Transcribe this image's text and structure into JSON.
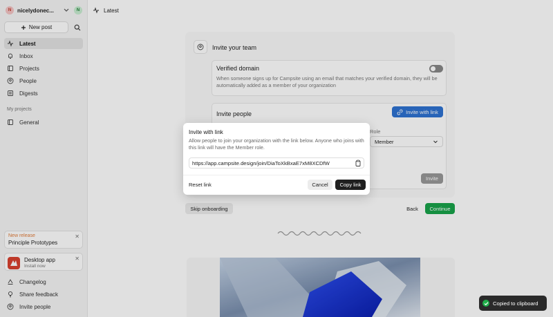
{
  "sidebar": {
    "org_initial": "N",
    "org_name": "nicelydonec...",
    "user_initial": "N",
    "new_post_label": "New post",
    "nav": [
      {
        "label": "Latest",
        "icon": "pulse-icon"
      },
      {
        "label": "Inbox",
        "icon": "bell-icon"
      },
      {
        "label": "Projects",
        "icon": "projects-icon"
      },
      {
        "label": "People",
        "icon": "person-icon"
      },
      {
        "label": "Digests",
        "icon": "digest-icon"
      }
    ],
    "my_projects_label": "My projects",
    "projects": [
      {
        "label": "General",
        "icon": "project-icon"
      }
    ],
    "release_card": {
      "tag": "New release",
      "title": "Principle Prototypes"
    },
    "desktop_card": {
      "title": "Desktop app",
      "subtitle": "Install now"
    },
    "footer": [
      {
        "label": "Changelog",
        "icon": "changelog-icon"
      },
      {
        "label": "Share feedback",
        "icon": "lightbulb-icon"
      },
      {
        "label": "Invite people",
        "icon": "invite-icon"
      }
    ]
  },
  "topbar": {
    "title": "Latest"
  },
  "onboarding": {
    "title": "Invite your team",
    "verified_domain": {
      "title": "Verified domain",
      "description": "When someone signs up for Campsite using an email that matches your verified domain, they will be automatically added as a member of your organization",
      "enabled": false
    },
    "invite_people": {
      "title": "Invite people",
      "invite_with_link_label": "Invite with link",
      "role_label": "Role",
      "role_value": "Member",
      "invite_label": "Invite"
    },
    "skip_label": "Skip onboarding",
    "back_label": "Back",
    "continue_label": "Continue"
  },
  "dialog": {
    "title": "Invite with link",
    "description": "Allow people to join your organization with the link below. Anyone who joins with this link will have the Member role.",
    "link": "https://app.campsite.design/join/DiaToXkBxaE7xM8XCDfW",
    "reset_label": "Reset link",
    "cancel_label": "Cancel",
    "copy_label": "Copy link"
  },
  "toast": {
    "message": "Copied to clipboard"
  },
  "colors": {
    "primary_blue": "#2e72d2",
    "continue_green": "#18a34a",
    "toast_bg": "#2a2a2a",
    "release_orange": "#e07b39",
    "app_red": "#d9412f"
  }
}
